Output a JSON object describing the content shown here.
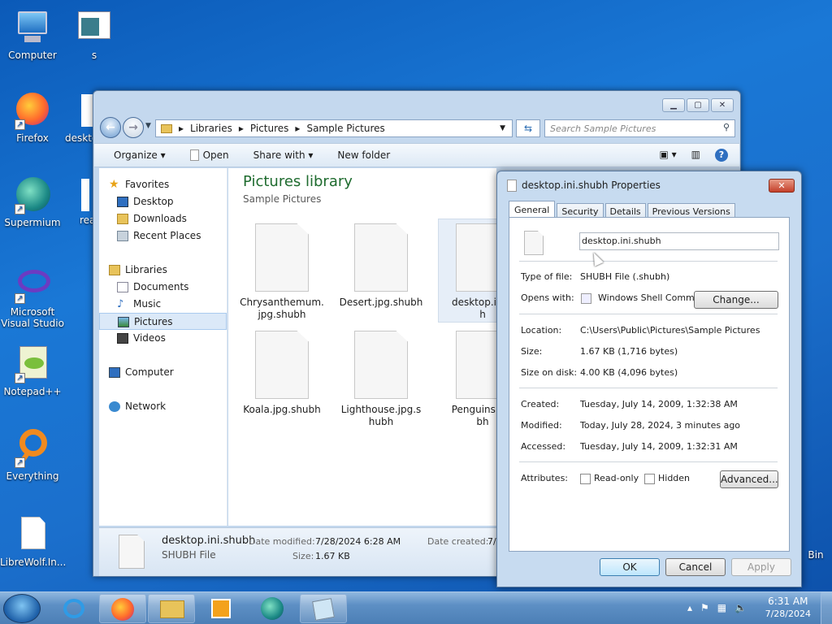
{
  "desktop": {
    "icons": [
      "Computer",
      "s",
      "Firefox",
      "deskto",
      "Supermium",
      "rea",
      "Microsoft Visual Studio",
      "Notepad++",
      "Everything",
      "LibreWolf.In...",
      "Bin"
    ]
  },
  "explorer": {
    "breadcrumb": [
      "Libraries",
      "Pictures",
      "Sample Pictures"
    ],
    "search_placeholder": "Search Sample Pictures",
    "toolbar": {
      "organize": "Organize",
      "open": "Open",
      "share_with": "Share with",
      "new_folder": "New folder"
    },
    "nav": {
      "favorites": "Favorites",
      "desktop": "Desktop",
      "downloads": "Downloads",
      "recent": "Recent Places",
      "libraries": "Libraries",
      "documents": "Documents",
      "music": "Music",
      "pictures": "Pictures",
      "videos": "Videos",
      "computer": "Computer",
      "network": "Network"
    },
    "content_title": "Pictures library",
    "content_sub": "Sample Pictures",
    "files": [
      {
        "line1": "Chrysanthemum.",
        "line2": "jpg.shubh"
      },
      {
        "line1": "Desert.jpg.shubh",
        "line2": ""
      },
      {
        "line1": "desktop.ini.s",
        "line2": "h"
      },
      {
        "line1": "Koala.jpg.shubh",
        "line2": ""
      },
      {
        "line1": "Lighthouse.jpg.s",
        "line2": "hubh"
      },
      {
        "line1": "Penguins.jpg",
        "line2": "bh"
      }
    ],
    "details": {
      "name": "desktop.ini.shubh",
      "type": "SHUBH File",
      "modified_label": "Date modified:",
      "modified": "7/28/2024 6:28 AM",
      "size_label": "Size:",
      "size": "1.67 KB",
      "created_label": "Date created:",
      "created": "7/"
    }
  },
  "properties": {
    "title": "desktop.ini.shubh Properties",
    "tabs": [
      "General",
      "Security",
      "Details",
      "Previous Versions"
    ],
    "filename": "desktop.ini.shubh",
    "type_label": "Type of file:",
    "type": "SHUBH File (.shubh)",
    "opens_label": "Opens with:",
    "opens": "Windows Shell Commor",
    "change": "Change...",
    "location_label": "Location:",
    "location": "C:\\Users\\Public\\Pictures\\Sample Pictures",
    "size_label": "Size:",
    "size": "1.67 KB (1,716 bytes)",
    "disk_label": "Size on disk:",
    "disk": "4.00 KB (4,096 bytes)",
    "created_label": "Created:",
    "created": "Tuesday, July 14, 2009, 1:32:38 AM",
    "modified_label": "Modified:",
    "modified": "Today, July 28, 2024, 3 minutes ago",
    "accessed_label": "Accessed:",
    "accessed": "Tuesday, July 14, 2009, 1:32:31 AM",
    "attr_label": "Attributes:",
    "readonly": "Read-only",
    "hidden": "Hidden",
    "advanced": "Advanced...",
    "ok": "OK",
    "cancel": "Cancel",
    "apply": "Apply"
  },
  "taskbar": {
    "time": "6:31 AM",
    "date": "7/28/2024"
  }
}
